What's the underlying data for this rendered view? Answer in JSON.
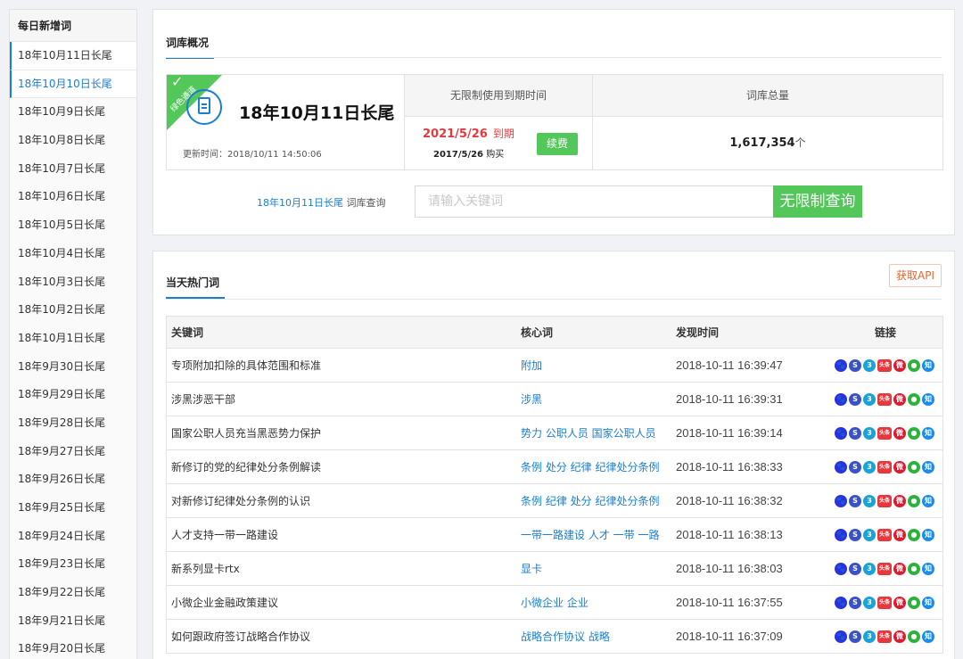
{
  "sidebar": {
    "title": "每日新增词",
    "items": [
      "18年10月11日长尾",
      "18年10月10日长尾",
      "18年10月9日长尾",
      "18年10月8日长尾",
      "18年10月7日长尾",
      "18年10月6日长尾",
      "18年10月5日长尾",
      "18年10月4日长尾",
      "18年10月3日长尾",
      "18年10月2日长尾",
      "18年10月1日长尾",
      "18年9月30日长尾",
      "18年9月29日长尾",
      "18年9月28日长尾",
      "18年9月27日长尾",
      "18年9月26日长尾",
      "18年9月25日长尾",
      "18年9月24日长尾",
      "18年9月23日长尾",
      "18年9月22日长尾",
      "18年9月21日长尾",
      "18年9月20日长尾"
    ],
    "active_index": 1
  },
  "overview": {
    "tab": "词库概况",
    "ribbon": "绿色通道",
    "lib_name": "18年10月11日长尾",
    "updated": "更新时间：2018/10/11 14:50:06",
    "col_expire": "无限制使用到期时间",
    "col_total": "词库总量",
    "expire_date": "2021/5/26",
    "expire_suffix": "到期",
    "buy_date": "2017/5/26",
    "buy_suffix": "购买",
    "renew_label": "续费",
    "total": "1,617,354",
    "total_unit": "个"
  },
  "query": {
    "lib_name": "18年10月11日长尾",
    "label_suffix": " 词库查询",
    "placeholder": "请输入关键词",
    "button": "无限制查询"
  },
  "hot": {
    "tab": "当天热门词",
    "api_button": "获取API",
    "headers": {
      "keyword": "关键词",
      "core": "核心词",
      "time": "发现时间",
      "links": "链接"
    },
    "link_icons": [
      "baidu-icon",
      "sogou-icon",
      "so360-icon",
      "toutiao-icon",
      "weibo-icon",
      "wechat-icon",
      "zhihu-icon"
    ],
    "rows": [
      {
        "keyword": "专项附加扣除的具体范围和标准",
        "core": "附加",
        "time": "2018-10-11 16:39:47"
      },
      {
        "keyword": "涉黑涉恶干部",
        "core": "涉黑",
        "time": "2018-10-11 16:39:31"
      },
      {
        "keyword": "国家公职人员充当黑恶势力保护",
        "core": "势力 公职人员 国家公职人员",
        "time": "2018-10-11 16:39:14"
      },
      {
        "keyword": "新修订的党的纪律处分条例解读",
        "core": "条例 处分 纪律 纪律处分条例",
        "time": "2018-10-11 16:38:33"
      },
      {
        "keyword": "对新修订纪律处分条例的认识",
        "core": "条例 纪律 处分 纪律处分条例",
        "time": "2018-10-11 16:38:32"
      },
      {
        "keyword": "人才支持一带一路建设",
        "core": "一带一路建设 人才 一带 一路",
        "time": "2018-10-11 16:38:13"
      },
      {
        "keyword": "新系列显卡rtx",
        "core": "显卡",
        "time": "2018-10-11 16:38:03"
      },
      {
        "keyword": "小微企业金融政策建议",
        "core": "小微企业 企业",
        "time": "2018-10-11 16:37:55"
      },
      {
        "keyword": "如何跟政府签订战略合作协议",
        "core": "战略合作协议 战略",
        "time": "2018-10-11 16:37:09"
      }
    ]
  }
}
